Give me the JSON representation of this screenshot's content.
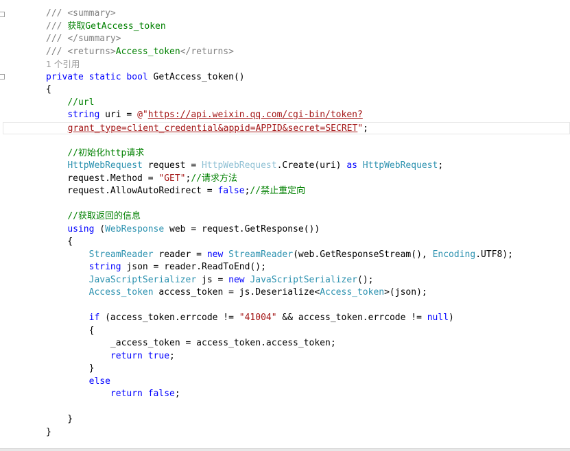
{
  "editor": {
    "lines": [
      [
        {
          "t": "/// ",
          "c": "doctag"
        },
        {
          "t": "<summary>",
          "c": "doctag"
        }
      ],
      [
        {
          "t": "/// ",
          "c": "doctag"
        },
        {
          "t": "获取GetAccess_token",
          "c": "comment"
        }
      ],
      [
        {
          "t": "/// ",
          "c": "doctag"
        },
        {
          "t": "</summary>",
          "c": "doctag"
        }
      ],
      [
        {
          "t": "/// ",
          "c": "doctag"
        },
        {
          "t": "<returns>",
          "c": "doctag"
        },
        {
          "t": "Access_token",
          "c": "comment"
        },
        {
          "t": "</returns>",
          "c": "doctag"
        }
      ],
      [
        {
          "t": "1 个引用",
          "c": "codelens"
        }
      ],
      [
        {
          "t": "private",
          "c": "keyword"
        },
        {
          "t": " "
        },
        {
          "t": "static",
          "c": "keyword"
        },
        {
          "t": " "
        },
        {
          "t": "bool",
          "c": "keyword"
        },
        {
          "t": " GetAccess_token()"
        }
      ],
      [
        {
          "t": "{"
        }
      ],
      [
        {
          "t": "    "
        },
        {
          "t": "//url",
          "c": "comment"
        }
      ],
      [
        {
          "t": "    "
        },
        {
          "t": "string",
          "c": "keyword"
        },
        {
          "t": " uri = "
        },
        {
          "t": "@\"",
          "c": "string"
        },
        {
          "t": "https://api.weixin.qq.com/cgi-bin/token?",
          "c": "link"
        }
      ],
      [
        {
          "t": "  "
        },
        {
          "t": "grant_type=client_credential&appid=APPID&secret=SECRET",
          "c": "link"
        },
        {
          "t": "\"",
          "c": "string"
        },
        {
          "t": ";"
        }
      ],
      [],
      [
        {
          "t": "    "
        },
        {
          "t": "//初始化http请求",
          "c": "comment"
        }
      ],
      [
        {
          "t": "    "
        },
        {
          "t": "HttpWebRequest",
          "c": "type"
        },
        {
          "t": " request = "
        },
        {
          "t": "HttpWebRequest",
          "c": "type-faded"
        },
        {
          "t": ".Create(uri) "
        },
        {
          "t": "as",
          "c": "keyword"
        },
        {
          "t": " "
        },
        {
          "t": "HttpWebRequest",
          "c": "type"
        },
        {
          "t": ";"
        }
      ],
      [
        {
          "t": "    request.Method = "
        },
        {
          "t": "\"GET\"",
          "c": "string"
        },
        {
          "t": ";"
        },
        {
          "t": "//请求方法",
          "c": "comment"
        }
      ],
      [
        {
          "t": "    request.AllowAutoRedirect = "
        },
        {
          "t": "false",
          "c": "keyword"
        },
        {
          "t": ";"
        },
        {
          "t": "//禁止重定向",
          "c": "comment"
        }
      ],
      [],
      [
        {
          "t": "    "
        },
        {
          "t": "//获取返回的信息",
          "c": "comment"
        }
      ],
      [
        {
          "t": "    "
        },
        {
          "t": "using",
          "c": "keyword"
        },
        {
          "t": " ("
        },
        {
          "t": "WebResponse",
          "c": "type"
        },
        {
          "t": " web = request.GetResponse())"
        }
      ],
      [
        {
          "t": "    {"
        }
      ],
      [
        {
          "t": "        "
        },
        {
          "t": "StreamReader",
          "c": "type"
        },
        {
          "t": " reader = "
        },
        {
          "t": "new",
          "c": "keyword"
        },
        {
          "t": " "
        },
        {
          "t": "StreamReader",
          "c": "type"
        },
        {
          "t": "(web.GetResponseStream(), "
        },
        {
          "t": "Encoding",
          "c": "type"
        },
        {
          "t": ".UTF8);"
        }
      ],
      [
        {
          "t": "        "
        },
        {
          "t": "string",
          "c": "keyword"
        },
        {
          "t": " json = reader.ReadToEnd();"
        }
      ],
      [
        {
          "t": "        "
        },
        {
          "t": "JavaScriptSerializer",
          "c": "type"
        },
        {
          "t": " js = "
        },
        {
          "t": "new",
          "c": "keyword"
        },
        {
          "t": " "
        },
        {
          "t": "JavaScriptSerializer",
          "c": "type"
        },
        {
          "t": "();"
        }
      ],
      [
        {
          "t": "        "
        },
        {
          "t": "Access_token",
          "c": "type"
        },
        {
          "t": " access_token = js.Deserialize<"
        },
        {
          "t": "Access_token",
          "c": "type"
        },
        {
          "t": ">(json);"
        }
      ],
      [],
      [
        {
          "t": "        "
        },
        {
          "t": "if",
          "c": "keyword"
        },
        {
          "t": " (access_token.errcode != "
        },
        {
          "t": "\"41004\"",
          "c": "string"
        },
        {
          "t": " && access_token.errcode != "
        },
        {
          "t": "null",
          "c": "keyword"
        },
        {
          "t": ")"
        }
      ],
      [
        {
          "t": "        {"
        }
      ],
      [
        {
          "t": "            _access_token = access_token.access_token;"
        }
      ],
      [
        {
          "t": "            "
        },
        {
          "t": "return",
          "c": "keyword"
        },
        {
          "t": " "
        },
        {
          "t": "true",
          "c": "keyword"
        },
        {
          "t": ";"
        }
      ],
      [
        {
          "t": "        }"
        }
      ],
      [
        {
          "t": "        "
        },
        {
          "t": "else",
          "c": "keyword"
        }
      ],
      [
        {
          "t": "            "
        },
        {
          "t": "return",
          "c": "keyword"
        },
        {
          "t": " "
        },
        {
          "t": "false",
          "c": "keyword"
        },
        {
          "t": ";"
        }
      ],
      [],
      [
        {
          "t": "    }"
        }
      ],
      [
        {
          "t": "}"
        }
      ]
    ]
  }
}
